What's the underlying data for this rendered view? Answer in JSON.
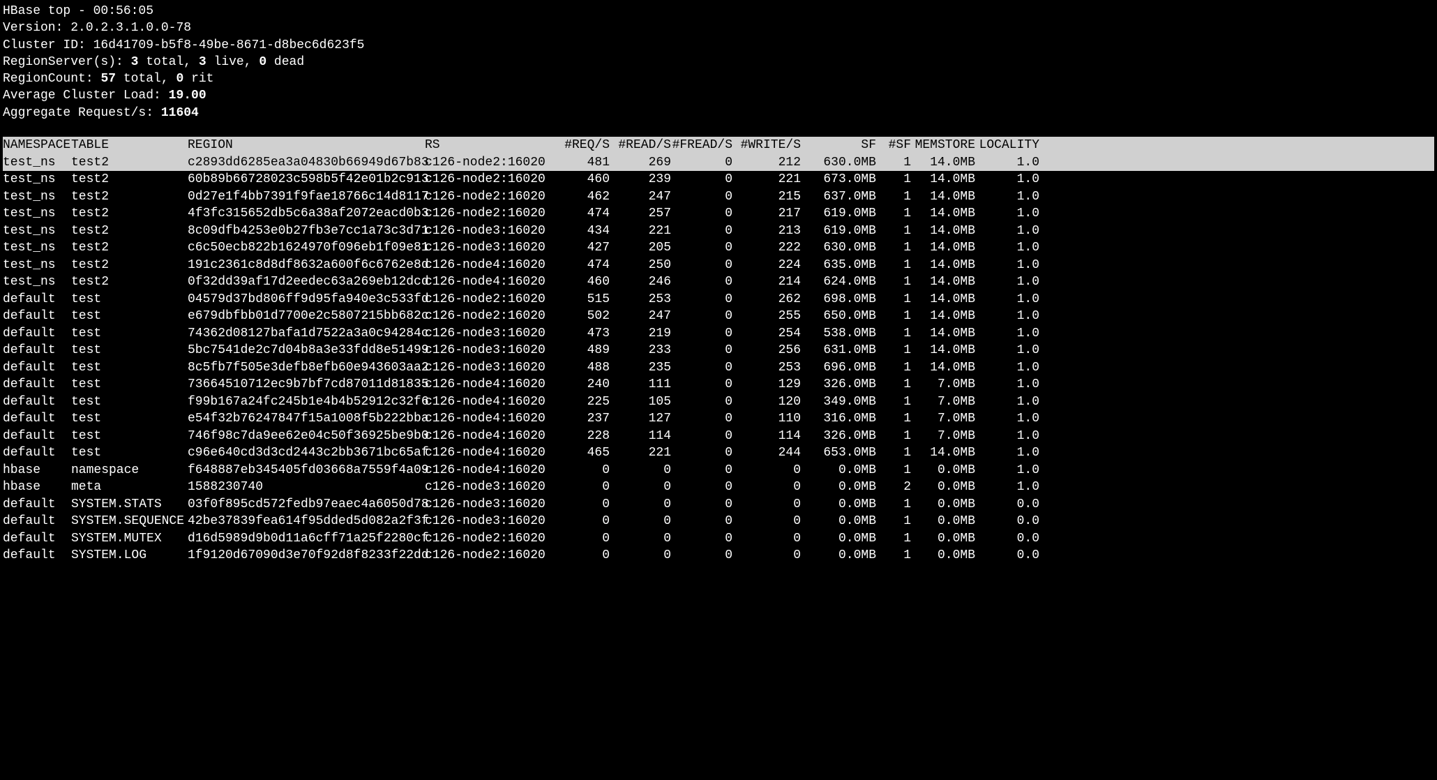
{
  "header": {
    "title": "HBase top - ",
    "timestamp": "00:56:05",
    "version_label": "Version: ",
    "version": "2.0.2.3.1.0.0-78",
    "cluster_id_label": "Cluster ID: ",
    "cluster_id": "16d41709-b5f8-49be-8671-d8bec6d623f5",
    "regionserver_label": "RegionServer(s): ",
    "rs_total": "3",
    "rs_total_suffix": " total, ",
    "rs_live": "3",
    "rs_live_suffix": " live, ",
    "rs_dead": "0",
    "rs_dead_suffix": " dead",
    "regioncount_label": "RegionCount: ",
    "rc_total": "57",
    "rc_total_suffix": " total, ",
    "rc_rit": "0",
    "rc_rit_suffix": " rit",
    "avg_load_label": "Average Cluster Load: ",
    "avg_load": "19.00",
    "agg_req_label": "Aggregate Request/s: ",
    "agg_req": "11604"
  },
  "columns": {
    "namespace": "NAMESPACE",
    "table": "TABLE",
    "region": "REGION",
    "rs": "RS",
    "reqs": "#REQ/S",
    "reads": "#READ/S",
    "freads": "#FREAD/S",
    "writes": "#WRITE/S",
    "sf": "SF",
    "nsf": "#SF",
    "memstore": "MEMSTORE",
    "locality": "LOCALITY"
  },
  "rows": [
    {
      "namespace": "test_ns",
      "table": "test2",
      "region": "c2893dd6285ea3a04830b66949d67b83",
      "rs": "c126-node2:16020",
      "reqs": "481",
      "reads": "269",
      "freads": "0",
      "writes": "212",
      "sf": "630.0MB",
      "nsf": "1",
      "memstore": "14.0MB",
      "locality": "1.0",
      "highlighted": true
    },
    {
      "namespace": "test_ns",
      "table": "test2",
      "region": "60b89b66728023c598b5f42e01b2c913",
      "rs": "c126-node2:16020",
      "reqs": "460",
      "reads": "239",
      "freads": "0",
      "writes": "221",
      "sf": "673.0MB",
      "nsf": "1",
      "memstore": "14.0MB",
      "locality": "1.0"
    },
    {
      "namespace": "test_ns",
      "table": "test2",
      "region": "0d27e1f4bb7391f9fae18766c14d8117",
      "rs": "c126-node2:16020",
      "reqs": "462",
      "reads": "247",
      "freads": "0",
      "writes": "215",
      "sf": "637.0MB",
      "nsf": "1",
      "memstore": "14.0MB",
      "locality": "1.0"
    },
    {
      "namespace": "test_ns",
      "table": "test2",
      "region": "4f3fc315652db5c6a38af2072eacd0b3",
      "rs": "c126-node2:16020",
      "reqs": "474",
      "reads": "257",
      "freads": "0",
      "writes": "217",
      "sf": "619.0MB",
      "nsf": "1",
      "memstore": "14.0MB",
      "locality": "1.0"
    },
    {
      "namespace": "test_ns",
      "table": "test2",
      "region": "8c09dfb4253e0b27fb3e7cc1a73c3d71",
      "rs": "c126-node3:16020",
      "reqs": "434",
      "reads": "221",
      "freads": "0",
      "writes": "213",
      "sf": "619.0MB",
      "nsf": "1",
      "memstore": "14.0MB",
      "locality": "1.0"
    },
    {
      "namespace": "test_ns",
      "table": "test2",
      "region": "c6c50ecb822b1624970f096eb1f09e81",
      "rs": "c126-node3:16020",
      "reqs": "427",
      "reads": "205",
      "freads": "0",
      "writes": "222",
      "sf": "630.0MB",
      "nsf": "1",
      "memstore": "14.0MB",
      "locality": "1.0"
    },
    {
      "namespace": "test_ns",
      "table": "test2",
      "region": "191c2361c8d8df8632a600f6c6762e8d",
      "rs": "c126-node4:16020",
      "reqs": "474",
      "reads": "250",
      "freads": "0",
      "writes": "224",
      "sf": "635.0MB",
      "nsf": "1",
      "memstore": "14.0MB",
      "locality": "1.0"
    },
    {
      "namespace": "test_ns",
      "table": "test2",
      "region": "0f32dd39af17d2eedec63a269eb12dcd",
      "rs": "c126-node4:16020",
      "reqs": "460",
      "reads": "246",
      "freads": "0",
      "writes": "214",
      "sf": "624.0MB",
      "nsf": "1",
      "memstore": "14.0MB",
      "locality": "1.0"
    },
    {
      "namespace": "default",
      "table": "test",
      "region": "04579d37bd806ff9d95fa940e3c533fd",
      "rs": "c126-node2:16020",
      "reqs": "515",
      "reads": "253",
      "freads": "0",
      "writes": "262",
      "sf": "698.0MB",
      "nsf": "1",
      "memstore": "14.0MB",
      "locality": "1.0"
    },
    {
      "namespace": "default",
      "table": "test",
      "region": "e679dbfbb01d7700e2c5807215bb682c",
      "rs": "c126-node2:16020",
      "reqs": "502",
      "reads": "247",
      "freads": "0",
      "writes": "255",
      "sf": "650.0MB",
      "nsf": "1",
      "memstore": "14.0MB",
      "locality": "1.0"
    },
    {
      "namespace": "default",
      "table": "test",
      "region": "74362d08127bafa1d7522a3a0c94284c",
      "rs": "c126-node3:16020",
      "reqs": "473",
      "reads": "219",
      "freads": "0",
      "writes": "254",
      "sf": "538.0MB",
      "nsf": "1",
      "memstore": "14.0MB",
      "locality": "1.0"
    },
    {
      "namespace": "default",
      "table": "test",
      "region": "5bc7541de2c7d04b8a3e33fdd8e51499",
      "rs": "c126-node3:16020",
      "reqs": "489",
      "reads": "233",
      "freads": "0",
      "writes": "256",
      "sf": "631.0MB",
      "nsf": "1",
      "memstore": "14.0MB",
      "locality": "1.0"
    },
    {
      "namespace": "default",
      "table": "test",
      "region": "8c5fb7f505e3defb8efb60e943603aa2",
      "rs": "c126-node3:16020",
      "reqs": "488",
      "reads": "235",
      "freads": "0",
      "writes": "253",
      "sf": "696.0MB",
      "nsf": "1",
      "memstore": "14.0MB",
      "locality": "1.0"
    },
    {
      "namespace": "default",
      "table": "test",
      "region": "73664510712ec9b7bf7cd87011d81835",
      "rs": "c126-node4:16020",
      "reqs": "240",
      "reads": "111",
      "freads": "0",
      "writes": "129",
      "sf": "326.0MB",
      "nsf": "1",
      "memstore": "7.0MB",
      "locality": "1.0"
    },
    {
      "namespace": "default",
      "table": "test",
      "region": "f99b167a24fc245b1e4b4b52912c32f6",
      "rs": "c126-node4:16020",
      "reqs": "225",
      "reads": "105",
      "freads": "0",
      "writes": "120",
      "sf": "349.0MB",
      "nsf": "1",
      "memstore": "7.0MB",
      "locality": "1.0"
    },
    {
      "namespace": "default",
      "table": "test",
      "region": "e54f32b76247847f15a1008f5b222bba",
      "rs": "c126-node4:16020",
      "reqs": "237",
      "reads": "127",
      "freads": "0",
      "writes": "110",
      "sf": "316.0MB",
      "nsf": "1",
      "memstore": "7.0MB",
      "locality": "1.0"
    },
    {
      "namespace": "default",
      "table": "test",
      "region": "746f98c7da9ee62e04c50f36925be9b0",
      "rs": "c126-node4:16020",
      "reqs": "228",
      "reads": "114",
      "freads": "0",
      "writes": "114",
      "sf": "326.0MB",
      "nsf": "1",
      "memstore": "7.0MB",
      "locality": "1.0"
    },
    {
      "namespace": "default",
      "table": "test",
      "region": "c96e640cd3d3cd2443c2bb3671bc65af",
      "rs": "c126-node4:16020",
      "reqs": "465",
      "reads": "221",
      "freads": "0",
      "writes": "244",
      "sf": "653.0MB",
      "nsf": "1",
      "memstore": "14.0MB",
      "locality": "1.0"
    },
    {
      "namespace": "hbase",
      "table": "namespace",
      "region": "f648887eb345405fd03668a7559f4a09",
      "rs": "c126-node4:16020",
      "reqs": "0",
      "reads": "0",
      "freads": "0",
      "writes": "0",
      "sf": "0.0MB",
      "nsf": "1",
      "memstore": "0.0MB",
      "locality": "1.0"
    },
    {
      "namespace": "hbase",
      "table": "meta",
      "region": "1588230740",
      "rs": "c126-node3:16020",
      "reqs": "0",
      "reads": "0",
      "freads": "0",
      "writes": "0",
      "sf": "0.0MB",
      "nsf": "2",
      "memstore": "0.0MB",
      "locality": "1.0"
    },
    {
      "namespace": "default",
      "table": "SYSTEM.STATS",
      "region": "03f0f895cd572fedb97eaec4a6050d78",
      "rs": "c126-node3:16020",
      "reqs": "0",
      "reads": "0",
      "freads": "0",
      "writes": "0",
      "sf": "0.0MB",
      "nsf": "1",
      "memstore": "0.0MB",
      "locality": "0.0"
    },
    {
      "namespace": "default",
      "table": "SYSTEM.SEQUENCE",
      "region": "42be37839fea614f95dded5d082a2f3f",
      "rs": "c126-node3:16020",
      "reqs": "0",
      "reads": "0",
      "freads": "0",
      "writes": "0",
      "sf": "0.0MB",
      "nsf": "1",
      "memstore": "0.0MB",
      "locality": "0.0"
    },
    {
      "namespace": "default",
      "table": "SYSTEM.MUTEX",
      "region": "d16d5989d9b0d11a6cff71a25f2280cf",
      "rs": "c126-node2:16020",
      "reqs": "0",
      "reads": "0",
      "freads": "0",
      "writes": "0",
      "sf": "0.0MB",
      "nsf": "1",
      "memstore": "0.0MB",
      "locality": "0.0"
    },
    {
      "namespace": "default",
      "table": "SYSTEM.LOG",
      "region": "1f9120d67090d3e70f92d8f8233f22dd",
      "rs": "c126-node2:16020",
      "reqs": "0",
      "reads": "0",
      "freads": "0",
      "writes": "0",
      "sf": "0.0MB",
      "nsf": "1",
      "memstore": "0.0MB",
      "locality": "0.0"
    }
  ]
}
